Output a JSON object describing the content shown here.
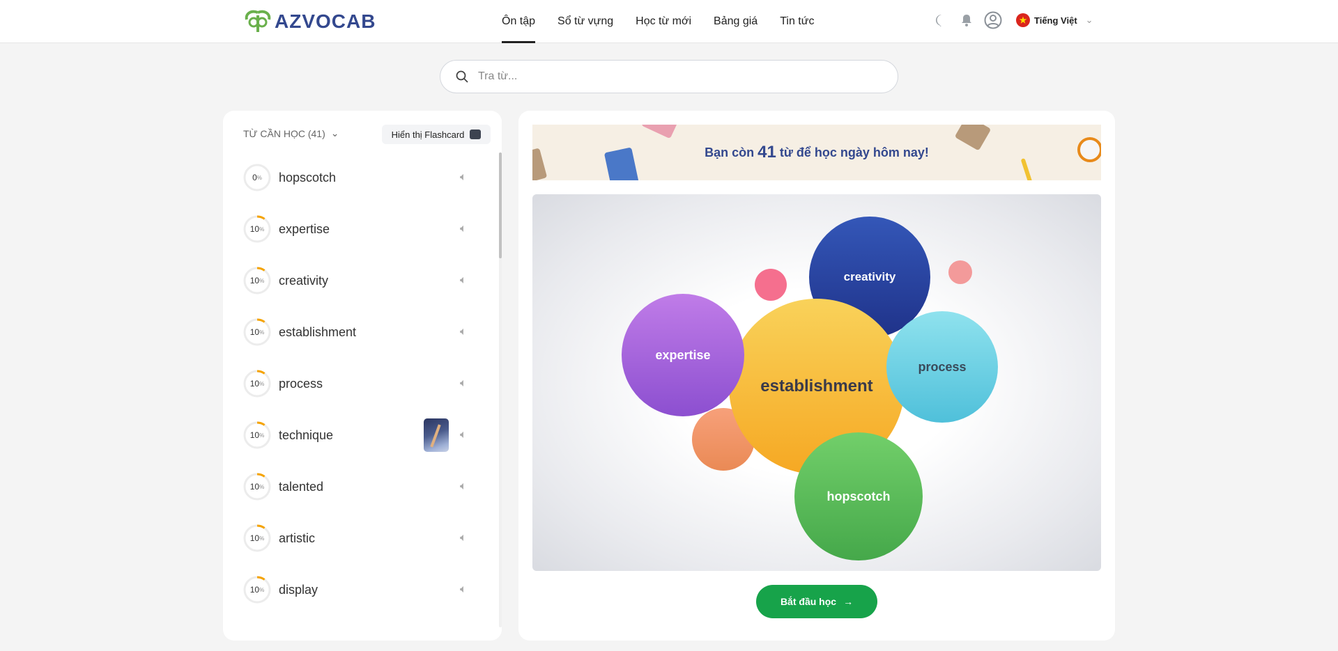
{
  "header": {
    "logo": "AZVOCAB",
    "nav": [
      "Ôn tập",
      "Sổ từ vựng",
      "Học từ mới",
      "Bảng giá",
      "Tin tức"
    ],
    "active_nav": 0,
    "language": "Tiếng Việt"
  },
  "search": {
    "placeholder": "Tra từ..."
  },
  "left": {
    "title": "TỪ CẦN HỌC (41)",
    "flashcard_label": "Hiển thị Flashcard",
    "words": [
      {
        "word": "hopscotch",
        "progress": 0
      },
      {
        "word": "expertise",
        "progress": 10
      },
      {
        "word": "creativity",
        "progress": 10
      },
      {
        "word": "establishment",
        "progress": 10
      },
      {
        "word": "process",
        "progress": 10
      },
      {
        "word": "technique",
        "progress": 10,
        "has_image": true
      },
      {
        "word": "talented",
        "progress": 10
      },
      {
        "word": "artistic",
        "progress": 10
      },
      {
        "word": "display",
        "progress": 10
      }
    ]
  },
  "banner": {
    "prefix": "Bạn còn",
    "count": "41",
    "suffix": "từ để học ngày hôm nay!"
  },
  "bubbles": {
    "creativity": "creativity",
    "establishment": "establishment",
    "expertise": "expertise",
    "process": "process",
    "hopscotch": "hopscotch"
  },
  "start_label": "Bắt đầu học",
  "colors": {
    "accent": "#17a34a",
    "brand": "#33488e",
    "progress": "#f5a300"
  }
}
